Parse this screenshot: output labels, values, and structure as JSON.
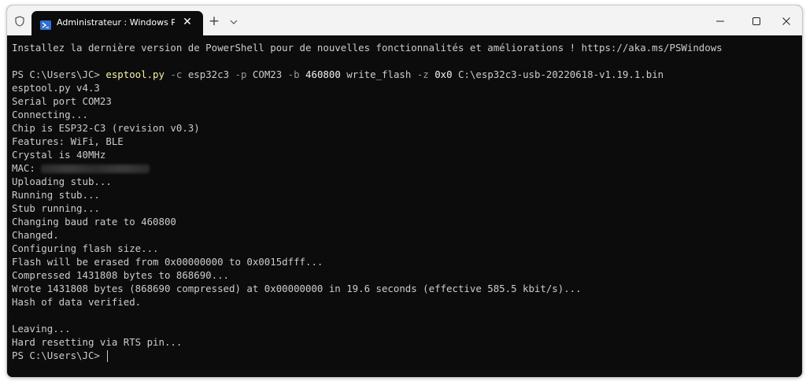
{
  "tab": {
    "title": "Administrateur : Windows PowerShell",
    "close_glyph": "✕",
    "new_tab_glyph": "+"
  },
  "window_controls": {
    "minimize": "—",
    "maximize": "☐",
    "close": "✕"
  },
  "terminal": {
    "banner": "Installez la dernière version de PowerShell pour de nouvelles fonctionnalités et améliorations ! https://aka.ms/PSWindows",
    "prompt": "PS C:\\Users\\JC> ",
    "command": {
      "exe": "esptool.py",
      "p1": " -c",
      "v1": " esp32c3",
      "p2": " -p",
      "v2": " COM23",
      "p3": " -b",
      "v3": " 460800",
      "v4": " write_flash",
      "p4": " -z",
      "v5": " 0x0",
      "v6": " C:\\esp32c3-usb-20220618-v1.19.1.bin"
    },
    "output": [
      "esptool.py v4.3",
      "Serial port COM23",
      "Connecting...",
      "Chip is ESP32-C3 (revision v0.3)",
      "Features: WiFi, BLE",
      "Crystal is 40MHz",
      "MAC: ",
      "Uploading stub...",
      "Running stub...",
      "Stub running...",
      "Changing baud rate to 460800",
      "Changed.",
      "Configuring flash size...",
      "Flash will be erased from 0x00000000 to 0x0015dfff...",
      "Compressed 1431808 bytes to 868690...",
      "Wrote 1431808 bytes (868690 compressed) at 0x00000000 in 19.6 seconds (effective 585.5 kbit/s)...",
      "Hash of data verified.",
      "",
      "Leaving...",
      "Hard resetting via RTS pin..."
    ],
    "final_prompt": "PS C:\\Users\\JC> "
  },
  "colors": {
    "terminal_bg": "#0c0c0c",
    "terminal_fg": "#cccccc",
    "command_yellow": "#f9f1a5",
    "parameter_gray": "#9a9a9a",
    "titlebar_bg": "#f3f3f3"
  },
  "icons": [
    "shield-icon",
    "powershell-icon",
    "close-icon",
    "plus-icon",
    "chevron-down-icon",
    "minimize-icon",
    "maximize-icon",
    "close-window-icon"
  ]
}
